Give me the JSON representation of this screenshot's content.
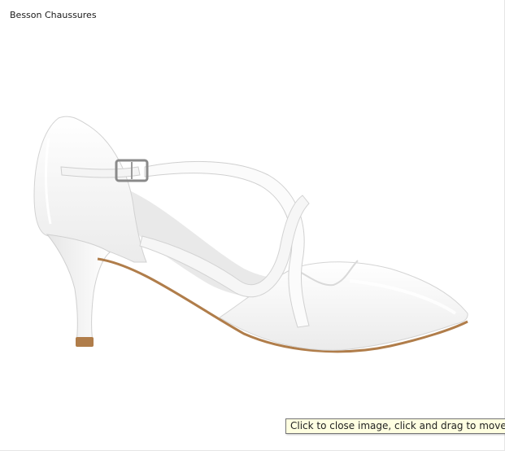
{
  "viewer": {
    "caption": "Besson Chaussures",
    "tooltip": "Click to close image, click and drag to move. Use a"
  },
  "image": {
    "subject": "white-pointed-pump-with-crossed-straps",
    "colors": {
      "shoe": "#f7f7f7",
      "shoe_shadow": "#dcdcdc",
      "sole": "#b07d4a",
      "background": "#ffffff"
    }
  }
}
